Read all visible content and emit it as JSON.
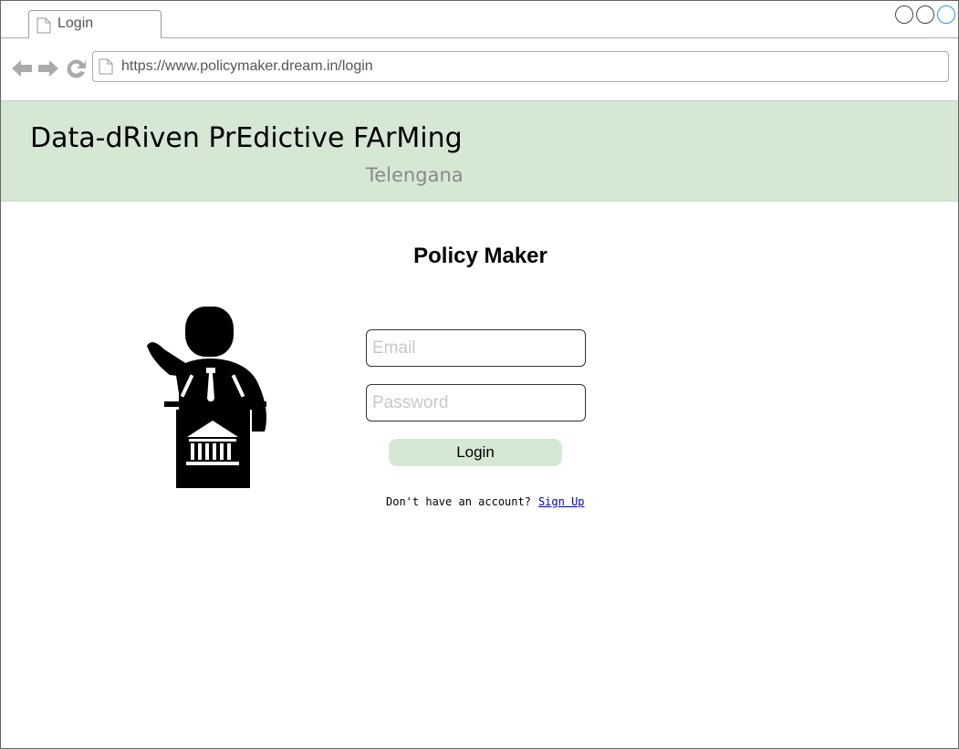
{
  "browser": {
    "tab_label": "Login",
    "url": "https://www.policymaker.dream.in/login"
  },
  "banner": {
    "title": "Data-dRiven PrEdictive FArMing",
    "subtitle": "Telengana",
    "color": "#d5e8d4"
  },
  "page": {
    "heading": "Policy Maker"
  },
  "form": {
    "email_placeholder": "Email",
    "password_placeholder": "Password",
    "login_label": "Login",
    "signup_prompt": "Don't have an account?",
    "signup_link": "Sign Up"
  },
  "icons": {
    "illustration": "policy-maker-podium-illustration",
    "back": "back-arrow-icon",
    "forward": "forward-arrow-icon",
    "reload": "reload-icon"
  }
}
